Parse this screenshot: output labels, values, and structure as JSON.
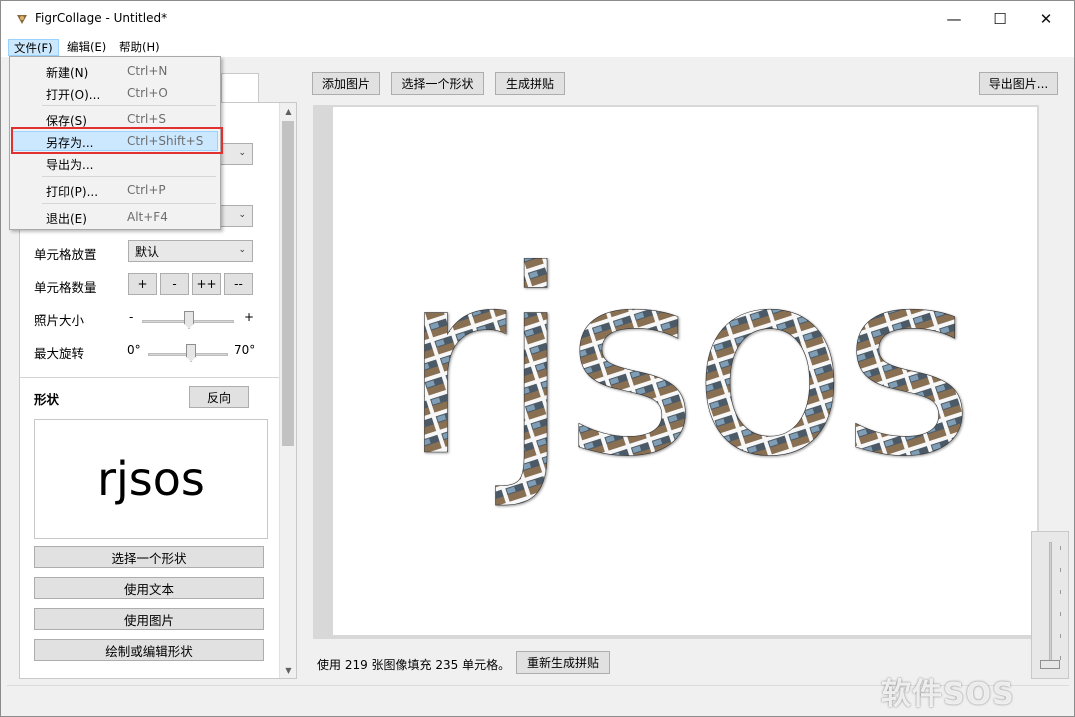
{
  "window": {
    "title": "FigrCollage - Untitled*",
    "controls": {
      "minimize": "—",
      "maximize": "☐",
      "close": "✕"
    }
  },
  "menubar": {
    "items": [
      "文件(F)",
      "编辑(E)",
      "帮助(H)"
    ],
    "active_index": 0
  },
  "file_menu": {
    "items": [
      {
        "label": "新建(N)",
        "shortcut": "Ctrl+N"
      },
      {
        "label": "打开(O)...",
        "shortcut": "Ctrl+O"
      },
      {
        "label": "保存(S)",
        "shortcut": "Ctrl+S"
      },
      {
        "label": "另存为...",
        "shortcut": "Ctrl+Shift+S",
        "highlighted": true
      },
      {
        "label": "导出为...",
        "shortcut": ""
      },
      {
        "label": "打印(P)...",
        "shortcut": "Ctrl+P"
      },
      {
        "label": "退出(E)",
        "shortcut": "Alt+F4"
      }
    ],
    "highlight_color": "#e03030"
  },
  "left_panel": {
    "cell_placement_label": "单元格放置",
    "cell_placement_value": "默认",
    "cell_count_label": "单元格数量",
    "cell_count_buttons": [
      "+",
      "-",
      "++",
      "--"
    ],
    "photo_size_label": "照片大小",
    "photo_size_min": "-",
    "photo_size_max": "+",
    "max_rotation_label": "最大旋转",
    "max_rotation_min": "0°",
    "max_rotation_max": "70°",
    "shape_title": "形状",
    "reverse_button": "反向",
    "shape_preview_text": "rjsos",
    "buttons": [
      "选择一个形状",
      "使用文本",
      "使用图片",
      "绘制或编辑形状"
    ]
  },
  "toolbar": {
    "add_images": "添加图片",
    "choose_shape": "选择一个形状",
    "generate": "生成拼贴",
    "export_image": "导出图片..."
  },
  "canvas": {
    "collage_text": "rjsos"
  },
  "status": {
    "text": "使用 219 张图像填充 235 单元格。",
    "regenerate_button": "重新生成拼贴"
  },
  "watermark": "软件SOS"
}
